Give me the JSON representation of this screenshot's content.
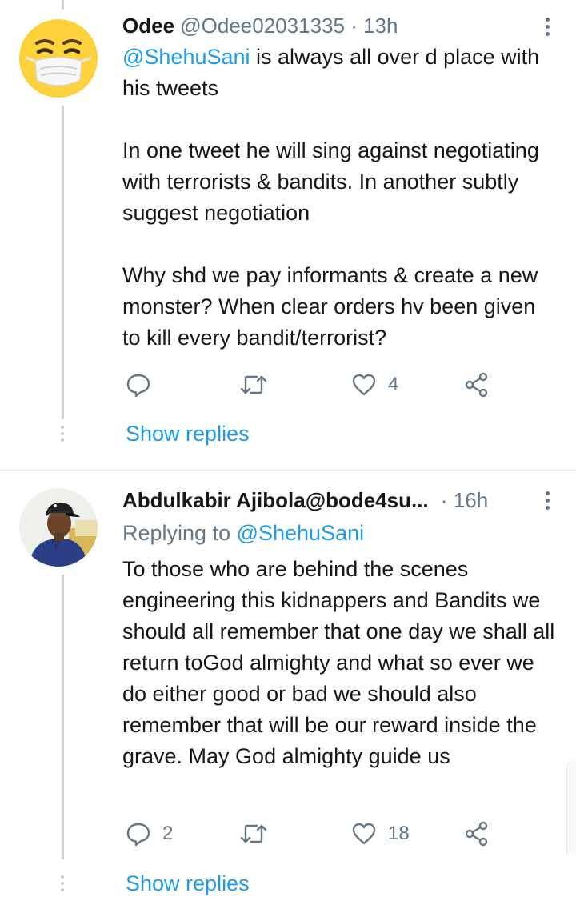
{
  "tweets": [
    {
      "name": "Odee",
      "handle": "@Odee02031335",
      "separator": "·",
      "time": "13h",
      "mention": "@ShehuSani",
      "text_after_mention": " is always all over d place with his tweets\n\nIn one tweet he will sing against negotiating with terrorists & bandits. In another subtly suggest negotiation\n\nWhy shd we pay informants & create a new monster? When clear orders hv been given to kill every bandit/terrorist?",
      "reply_count": "",
      "like_count": "4",
      "show_replies": "Show replies",
      "avatar": "face-with-mask-emoji"
    },
    {
      "name": "Abdulkabir Ajibola",
      "handle": "@bode4su...",
      "separator": "·",
      "time": "16h",
      "replying_prefix": "Replying to ",
      "replying_to": "@ShehuSani",
      "text": "To those who are behind the scenes engineering this kidnappers and Bandits we should all remember that one day we shall all return toGod almighty and what so ever we do either good or bad we should also remember that will be our reward inside the grave. May God almighty guide us",
      "reply_count": "2",
      "like_count": "18",
      "show_replies": "Show replies",
      "avatar": "profile-photo"
    }
  ],
  "icons": {
    "reply": "reply-icon",
    "retweet": "retweet-icon",
    "like": "heart-icon",
    "share": "share-icon",
    "more": "more-vertical-icon"
  },
  "colors": {
    "accent": "#1d9bf0",
    "text": "#14171a",
    "muted": "#657786",
    "divider": "#e1e8ed"
  }
}
